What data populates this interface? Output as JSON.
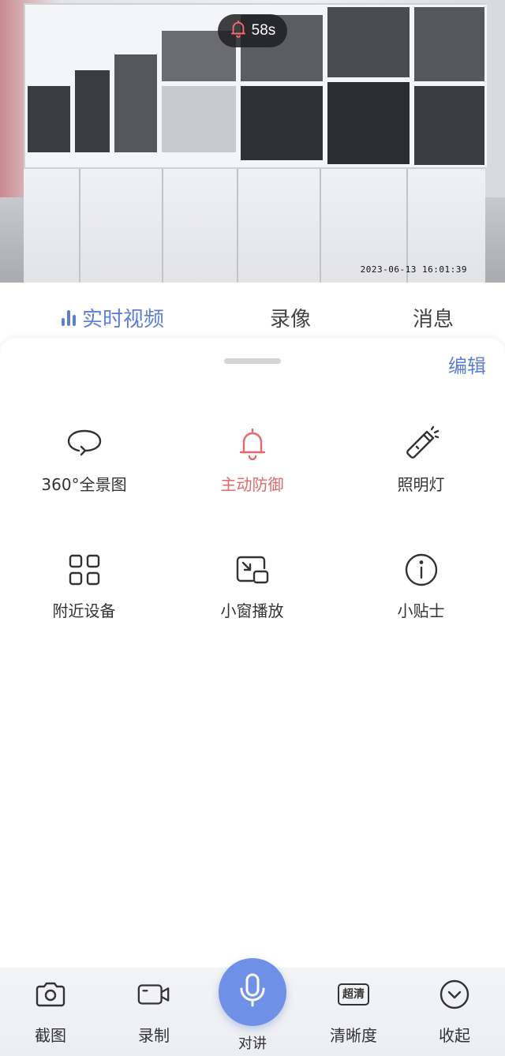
{
  "feed": {
    "alarm_countdown": "58s",
    "timestamp": "2023-06-13 16:01:39"
  },
  "tabs": [
    {
      "label": "实时视频",
      "active": true
    },
    {
      "label": "录像",
      "active": false
    },
    {
      "label": "消息",
      "active": false
    }
  ],
  "panel": {
    "edit_label": "编辑",
    "functions": [
      {
        "label": "360°全景图",
        "icon": "panorama-icon"
      },
      {
        "label": "主动防御",
        "icon": "bell-icon",
        "active_color": "#e06a6a"
      },
      {
        "label": "照明灯",
        "icon": "flashlight-icon"
      },
      {
        "label": "附近设备",
        "icon": "grid-icon"
      },
      {
        "label": "小窗播放",
        "icon": "picture-in-picture-icon"
      },
      {
        "label": "小贴士",
        "icon": "info-icon"
      }
    ]
  },
  "toolbar": {
    "screenshot_label": "截图",
    "record_label": "录制",
    "talk_label": "对讲",
    "quality_badge": "超清",
    "quality_label": "清晰度",
    "collapse_label": "收起"
  },
  "colors": {
    "accent": "#5b7fd6",
    "alert": "#e06a6a",
    "mic": "#6e90e6"
  }
}
